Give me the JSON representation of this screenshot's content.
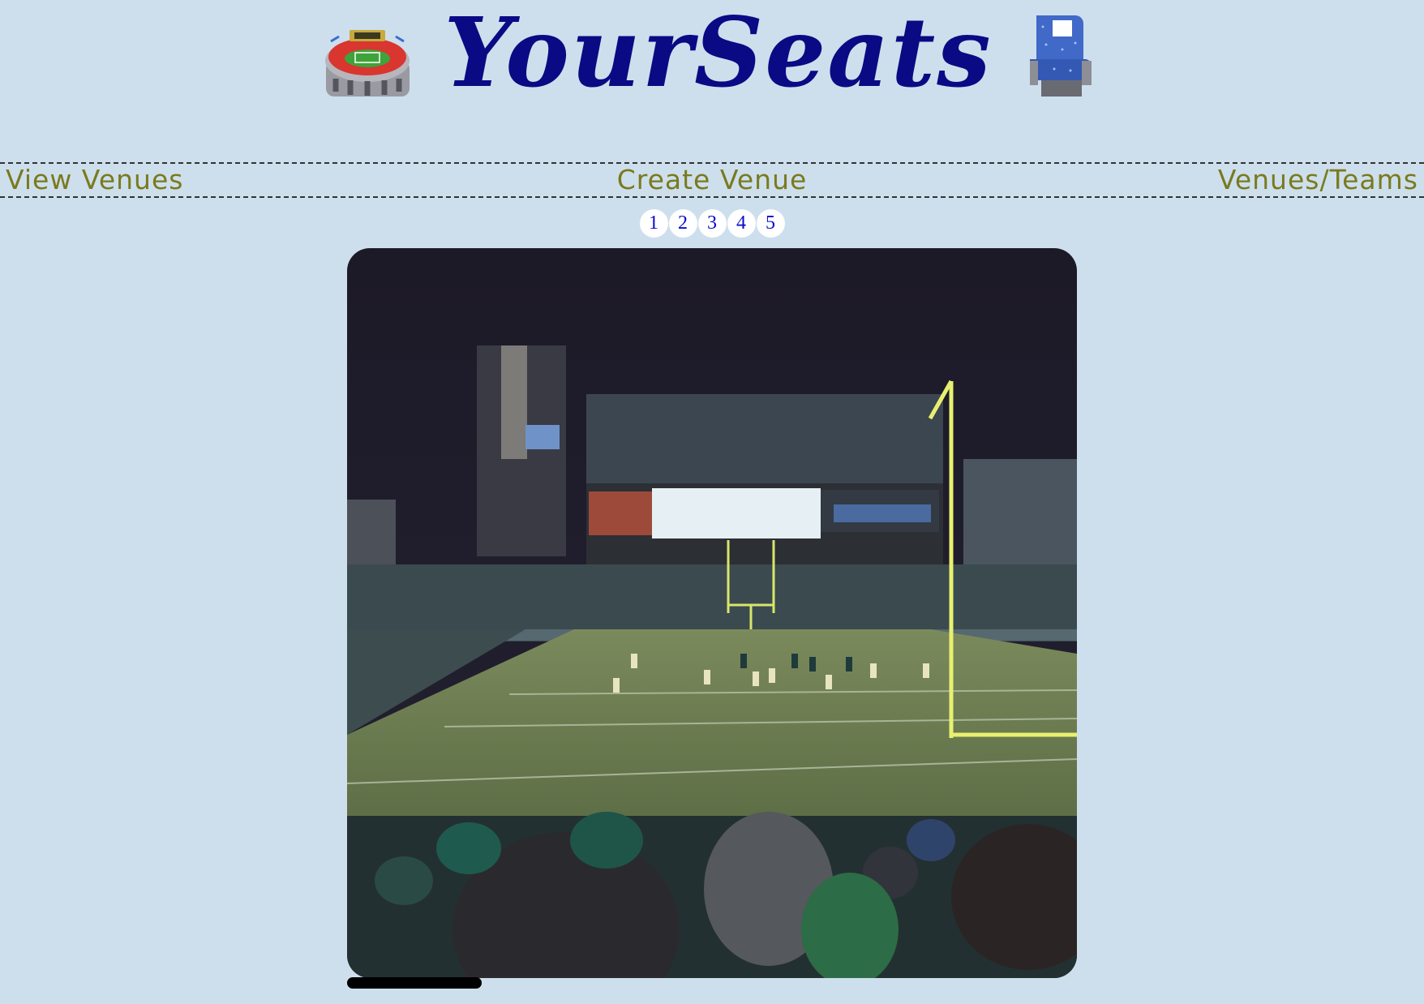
{
  "header": {
    "title": "YourSeats",
    "left_icon": "stadium-icon",
    "right_icon": "seat-icon"
  },
  "nav": {
    "view_venues": "View Venues",
    "create_venue": "Create Venue",
    "venues_teams": "Venues/Teams"
  },
  "pagination": {
    "pages": [
      "1",
      "2",
      "3",
      "4",
      "5"
    ]
  },
  "photo": {
    "description": "stadium-view-from-seat"
  },
  "colors": {
    "background": "#cddfec",
    "title": "#0a0a85",
    "nav_text": "#7a7a1e",
    "page_number": "#0a0ad0"
  }
}
